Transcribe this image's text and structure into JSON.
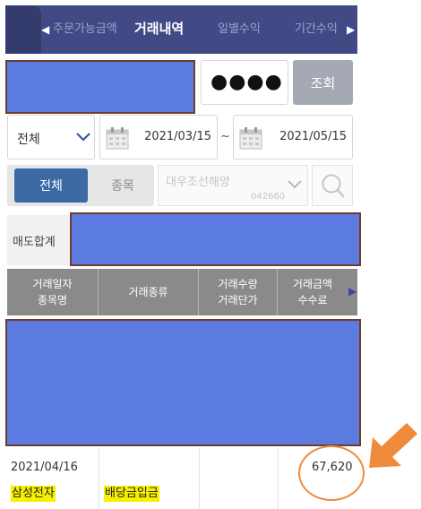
{
  "tabs": [
    {
      "label": "주문가능금액",
      "active": false
    },
    {
      "label": "거래내역",
      "active": true
    },
    {
      "label": "일별수익",
      "active": false
    },
    {
      "label": "기간수익",
      "active": false
    }
  ],
  "icons": {
    "tab_prev": "◀",
    "tab_next": "▶",
    "table_more": "▶"
  },
  "account": {
    "password_mask": "●●●●",
    "query_label": "조회"
  },
  "filter": {
    "type_selected": "전체",
    "start_date": "2021/03/15",
    "end_date": "2021/05/15",
    "range_sep": "~"
  },
  "scope": {
    "all_label": "전체",
    "stock_label": "종목",
    "stock_name": "대우조선해양",
    "stock_code": "042660"
  },
  "summary": {
    "sell_total_label": "매도합계"
  },
  "table": {
    "headers": [
      {
        "top": "거래일자",
        "bottom": "종목명"
      },
      {
        "top": "거래종류",
        "bottom": ""
      },
      {
        "top": "거래수량",
        "bottom": "거래단가"
      },
      {
        "top": "거래금액",
        "bottom": "수수료"
      }
    ],
    "rows": [
      {
        "date": "2021/04/16",
        "stock": "삼성전자",
        "type": "배당금입금",
        "qty": "",
        "price": "",
        "amount": "67,620",
        "fee": ""
      }
    ]
  },
  "colors": {
    "tab_bar": "#414a84",
    "active_segment": "#3b6aa4",
    "redaction": "#5b7be0",
    "highlight": "#f7f000",
    "annotation": "#ef8a3a"
  }
}
